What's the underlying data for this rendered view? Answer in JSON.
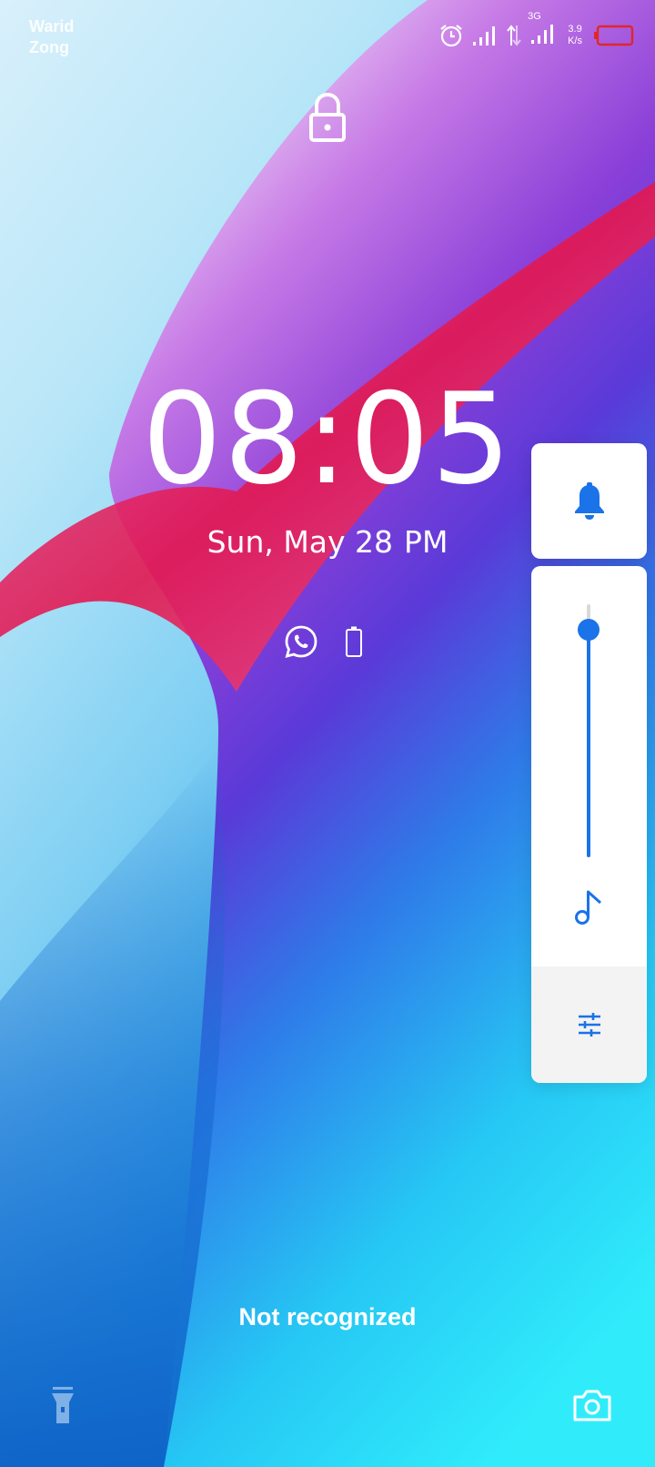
{
  "status_bar": {
    "carrier_1": "Warid",
    "carrier_2": "Zong",
    "network_type": "3G",
    "net_speed_value": "3.9",
    "net_speed_unit": "K/s",
    "icons": [
      "alarm-icon",
      "signal-icon",
      "data-arrows-icon",
      "signal-icon",
      "battery-icon"
    ]
  },
  "lock_screen": {
    "time": "08:05",
    "date": "Sun, May 28",
    "period": "PM",
    "notification_icons": [
      "whatsapp-icon",
      "battery-icon"
    ],
    "message": "Not recognized"
  },
  "volume_panel": {
    "mode_icon": "bell-icon",
    "stream_icon": "music-note-icon",
    "settings_icon": "sliders-icon",
    "level": 0.9,
    "accent_color": "#1a73e8"
  },
  "shortcuts": {
    "left": "flashlight-icon",
    "right": "camera-icon"
  }
}
